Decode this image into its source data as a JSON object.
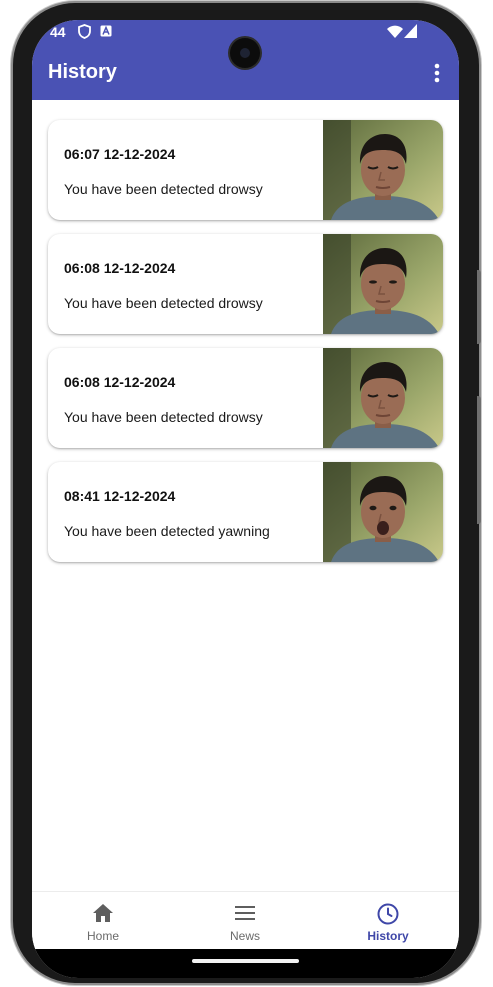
{
  "status_bar": {
    "time": "44",
    "icons": [
      "shield-icon",
      "a-badge-icon",
      "wifi-icon",
      "signal-icon"
    ]
  },
  "app_bar": {
    "title": "History",
    "menu_icon": "more-vert-icon",
    "color": "#4a52b4"
  },
  "history": [
    {
      "datetime": "06:07 12-12-2024",
      "message": "You have been detected drowsy",
      "expression": "eyes-closed"
    },
    {
      "datetime": "06:08 12-12-2024",
      "message": "You have been detected drowsy",
      "expression": "eyes-half"
    },
    {
      "datetime": "06:08 12-12-2024",
      "message": "You have been detected drowsy",
      "expression": "eyes-closed"
    },
    {
      "datetime": "08:41 12-12-2024",
      "message": "You have been detected yawning",
      "expression": "yawning"
    }
  ],
  "bottom_nav": {
    "items": [
      {
        "label": "Home",
        "icon": "home-icon",
        "active": false
      },
      {
        "label": "News",
        "icon": "menu-lines-icon",
        "active": false
      },
      {
        "label": "History",
        "icon": "clock-icon",
        "active": true
      }
    ],
    "active_color": "#3f47a8",
    "inactive_color": "#6b6b6b"
  }
}
